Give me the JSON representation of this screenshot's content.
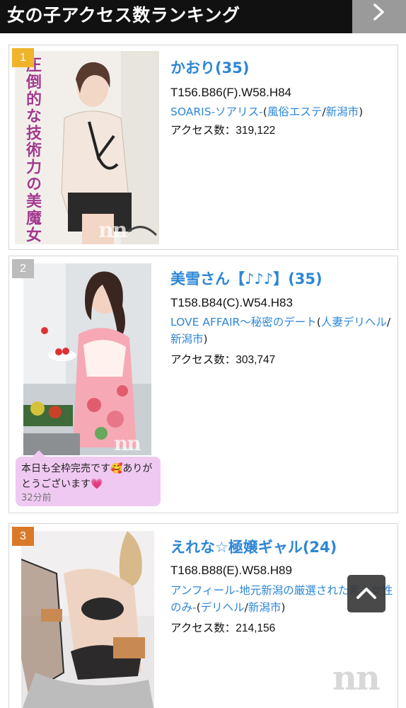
{
  "header": {
    "title": "女の子アクセス数ランキング",
    "more_icon": "chevron-right-icon"
  },
  "ranking": [
    {
      "rank": "1",
      "rank_color": "#f0b42a",
      "name": "かおり(35)",
      "stats": "T156.B86(F).W58.H84",
      "shop_name": "SOARIS-ソアリス-",
      "shop_genre": "風俗エステ",
      "shop_area": "新潟市",
      "access_label": "アクセス数：",
      "access_count": "319,122",
      "photo_caption": "圧倒的な技術力の美魔女"
    },
    {
      "rank": "2",
      "rank_color": "#bcbcbc",
      "name": "美雪さん【♪♪♪】(35)",
      "stats": "T158.B84(C).W54.H83",
      "shop_name": "LOVE AFFAIR～秘密のデート",
      "shop_genre": "人妻デリヘル",
      "shop_area": "新潟市",
      "access_label": "アクセス数：",
      "access_count": "303,747",
      "message": {
        "text": "本日も全枠完売です🥰ありがとうございます💗",
        "time": "32分前"
      }
    },
    {
      "rank": "3",
      "rank_color": "#d97a2a",
      "name": "えれな☆極嬢ギャル(24)",
      "stats": "T168.B88(E).W58.H89",
      "shop_name": "アンフィール-地元新潟の厳選された素人女性のみ-",
      "shop_genre": "デリヘル",
      "shop_area": "新潟市",
      "access_label": "アクセス数：",
      "access_count": "214,156"
    }
  ],
  "watermark": "nn",
  "scroll_top_icon": "chevron-up-icon"
}
